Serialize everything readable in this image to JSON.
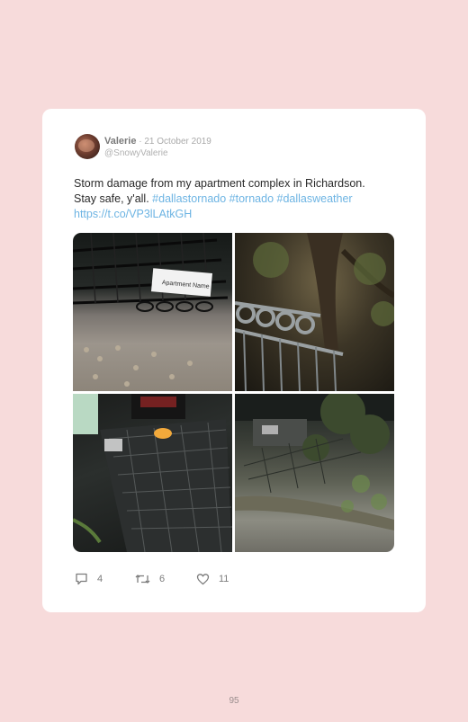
{
  "tweet": {
    "name": "Valerie",
    "separator": " · ",
    "date": "21 October 2019",
    "handle": "@SnowyValerie",
    "text_line1": "Storm damage from my apartment complex in Richardson.",
    "text_line2_prefix": "Stay safe, y'all.",
    "hashtags": [
      "#dallastornado",
      "#tornado",
      "#dallasweather"
    ],
    "link": "https://t.co/VP3lLAtkGH",
    "sign_text": "Apartment Name",
    "photos": [
      "fallen-iron-fence-on-gravel",
      "railing-under-tree-at-night",
      "twisted-metal-fence-with-people",
      "tree-down-in-parking-lot"
    ]
  },
  "stats": {
    "replies": "4",
    "retweets": "6",
    "likes": "11",
    "icons": [
      "reply-icon",
      "retweet-icon",
      "like-icon"
    ]
  },
  "colors": {
    "background": "#f7dbdb",
    "card": "#ffffff",
    "link": "#6db4e3",
    "text": "#2a2a2a"
  },
  "page": {
    "number": "95"
  }
}
